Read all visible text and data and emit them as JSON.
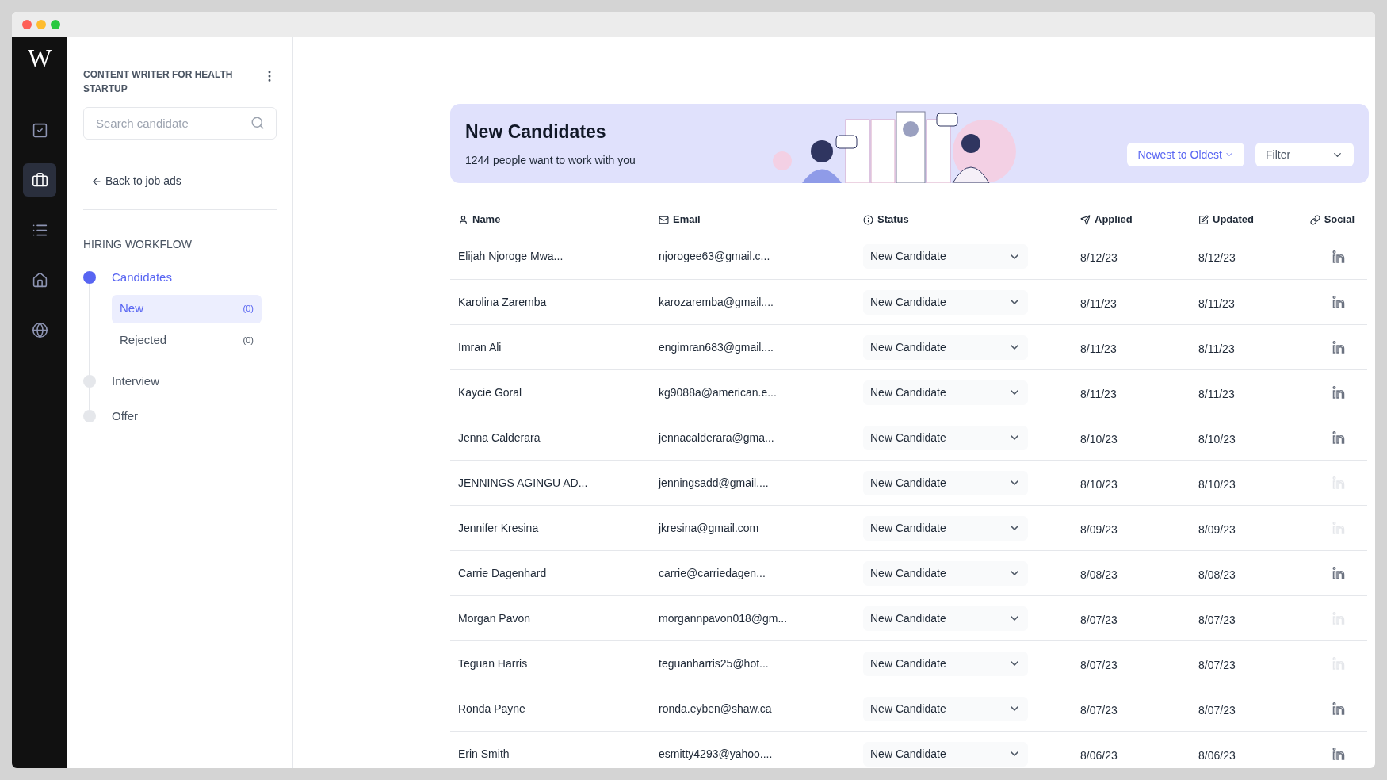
{
  "rail": {
    "logo": "W",
    "items": [
      {
        "selected": false
      },
      {
        "selected": true
      },
      {
        "selected": false
      },
      {
        "selected": false
      },
      {
        "selected": false
      }
    ]
  },
  "sidebar": {
    "job_title": "CONTENT WRITER FOR HEALTH STARTUP",
    "search": {
      "placeholder": "Search candidate"
    },
    "back_link": "Back to job ads",
    "workflow_title": "HIRING WORKFLOW",
    "stages": [
      {
        "label": "Candidates",
        "active": true,
        "children": [
          {
            "label": "New",
            "count": "(0)",
            "selected": true
          },
          {
            "label": "Rejected",
            "count": "(0)",
            "selected": false
          }
        ]
      },
      {
        "label": "Interview",
        "active": false
      },
      {
        "label": "Offer",
        "active": false
      }
    ]
  },
  "banner": {
    "title": "New Candidates",
    "subtitle": "1244 people want to work with you",
    "sort": "Newest to Oldest",
    "filter": "Filter"
  },
  "table": {
    "columns": [
      {
        "kind": "name",
        "label": "Name"
      },
      {
        "kind": "email",
        "label": "Email"
      },
      {
        "kind": "status",
        "label": "Status"
      },
      {
        "kind": "applied",
        "label": "Applied"
      },
      {
        "kind": "updated",
        "label": "Updated"
      },
      {
        "kind": "social",
        "label": "Social"
      }
    ],
    "rows": [
      {
        "name": "Elijah Njoroge Mwa...",
        "email": "njorogee63@gmail.c...",
        "status": "New Candidate",
        "applied": "8/12/23",
        "updated": "8/12/23",
        "social_linked": true
      },
      {
        "name": "Karolina Zaremba",
        "email": "karozaremba@gmail....",
        "status": "New Candidate",
        "applied": "8/11/23",
        "updated": "8/11/23",
        "social_linked": true
      },
      {
        "name": "Imran Ali",
        "email": "engimran683@gmail....",
        "status": "New Candidate",
        "applied": "8/11/23",
        "updated": "8/11/23",
        "social_linked": true
      },
      {
        "name": "Kaycie Goral",
        "email": "kg9088a@american.e...",
        "status": "New Candidate",
        "applied": "8/11/23",
        "updated": "8/11/23",
        "social_linked": true
      },
      {
        "name": "Jenna Calderara",
        "email": "jennacalderara@gma...",
        "status": "New Candidate",
        "applied": "8/10/23",
        "updated": "8/10/23",
        "social_linked": true
      },
      {
        "name": "JENNINGS AGINGU AD...",
        "email": "jenningsadd@gmail....",
        "status": "New Candidate",
        "applied": "8/10/23",
        "updated": "8/10/23",
        "social_linked": false
      },
      {
        "name": "Jennifer Kresina",
        "email": "jkresina@gmail.com",
        "status": "New Candidate",
        "applied": "8/09/23",
        "updated": "8/09/23",
        "social_linked": false
      },
      {
        "name": "Carrie Dagenhard",
        "email": "carrie@carriedagen...",
        "status": "New Candidate",
        "applied": "8/08/23",
        "updated": "8/08/23",
        "social_linked": true
      },
      {
        "name": "Morgan Pavon",
        "email": "morgannpavon018@gm...",
        "status": "New Candidate",
        "applied": "8/07/23",
        "updated": "8/07/23",
        "social_linked": false
      },
      {
        "name": "Teguan Harris",
        "email": "teguanharris25@hot...",
        "status": "New Candidate",
        "applied": "8/07/23",
        "updated": "8/07/23",
        "social_linked": false
      },
      {
        "name": "Ronda Payne",
        "email": "ronda.eyben@shaw.ca",
        "status": "New Candidate",
        "applied": "8/07/23",
        "updated": "8/07/23",
        "social_linked": true
      },
      {
        "name": "Erin Smith",
        "email": "esmitty4293@yahoo....",
        "status": "New Candidate",
        "applied": "8/06/23",
        "updated": "8/06/23",
        "social_linked": true
      }
    ]
  }
}
